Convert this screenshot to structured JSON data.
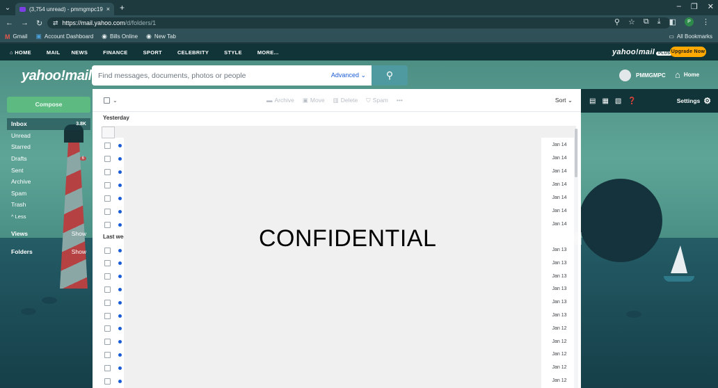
{
  "browser": {
    "tab_title": "(3,754 unread) - pmmgmpc19",
    "tab_close": "×",
    "new_tab": "+",
    "url_host": "https://mail.yahoo.com",
    "url_path": "/d/folders/1",
    "bookmarks": [
      {
        "label": "Gmail",
        "icon": "M"
      },
      {
        "label": "Account Dashboard",
        "icon": "▣"
      },
      {
        "label": "Bills Online",
        "icon": "◉"
      },
      {
        "label": "New Tab",
        "icon": "◉"
      }
    ],
    "all_bookmarks": "All Bookmarks",
    "profile_initial": "P"
  },
  "topnav": {
    "items": [
      "HOME",
      "MAIL",
      "NEWS",
      "FINANCE",
      "SPORT",
      "CELEBRITY",
      "STYLE",
      "MORE..."
    ],
    "logo": "yahoo!mail",
    "logo_badge": "PLUS",
    "upgrade": "Upgrade Now"
  },
  "header": {
    "logo": "yahoo!mail",
    "search_placeholder": "Find messages, documents, photos or people",
    "advanced": "Advanced ⌄",
    "user": "PMMGMPC",
    "home": "Home"
  },
  "sidebar": {
    "compose": "Compose",
    "folders": [
      {
        "label": "Inbox",
        "count": "3.8K"
      },
      {
        "label": "Unread",
        "count": ""
      },
      {
        "label": "Starred",
        "count": ""
      },
      {
        "label": "Drafts",
        "count": "6"
      },
      {
        "label": "Sent",
        "count": ""
      },
      {
        "label": "Archive",
        "count": ""
      },
      {
        "label": "Spam",
        "count": ""
      },
      {
        "label": "Trash",
        "count": ""
      },
      {
        "label": "^ Less",
        "count": ""
      }
    ],
    "views": "Views",
    "views_show": "Show",
    "folders_label": "Folders",
    "folders_show": "Show"
  },
  "toolbar": {
    "archive": "Archive",
    "move": "Move",
    "delete": "Delete",
    "spam": "Spam",
    "more": "•••",
    "sort": "Sort ⌄"
  },
  "list": {
    "group_yesterday": "Yesterday",
    "group_lastweek": "Last wee",
    "dates_yesterday": [
      "Jan 14",
      "Jan 14",
      "Jan 14",
      "Jan 14",
      "Jan 14",
      "Jan 14",
      "Jan 14"
    ],
    "dates_lastweek": [
      "Jan 13",
      "Jan 13",
      "Jan 13",
      "Jan 13",
      "Jan 13",
      "Jan 13",
      "Jan 12",
      "Jan 12",
      "Jan 12",
      "Jan 12",
      "Jan 12"
    ],
    "overlay": "CONFIDENTIAL"
  },
  "rail": {
    "settings": "Settings"
  }
}
